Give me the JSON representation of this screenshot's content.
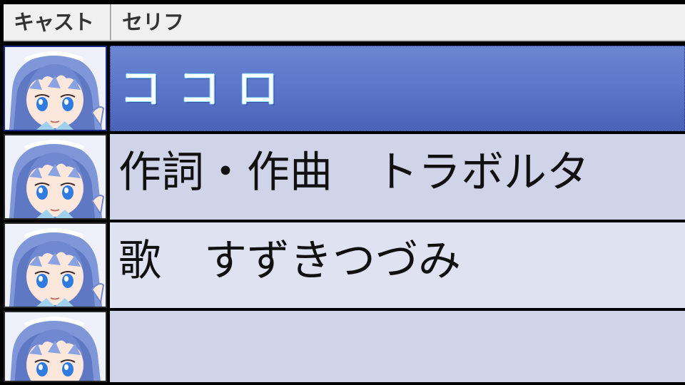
{
  "header": {
    "cast_label": "キャスト",
    "serif_label": "セリフ"
  },
  "rows": [
    {
      "serif": "ココロ",
      "selected": true
    },
    {
      "serif": "作詞・作曲　トラボルタ",
      "selected": false
    },
    {
      "serif": "歌　すずきつづみ",
      "selected": false
    },
    {
      "serif": "",
      "selected": false
    }
  ],
  "colors": {
    "selected_row": "#5a74c8",
    "row_even": "#cfd4e8",
    "row_odd": "#dfe3f1",
    "header_bg": "#f0f0f0"
  },
  "icons": {
    "cast_avatar": "character-avatar-icon"
  }
}
